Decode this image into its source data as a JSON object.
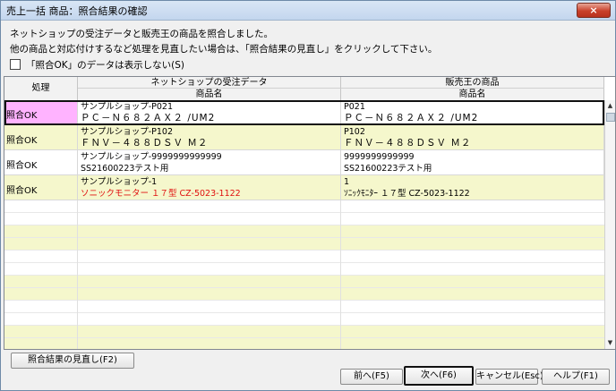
{
  "window": {
    "title": "売上一括 商品：照合結果の確認",
    "close": "×"
  },
  "messages": [
    "ネットショップの受注データと販売王の商品を照合しました。",
    "他の商品と対応付けするなど処理を見直したい場合は、「照合結果の見直し」をクリックして下さい。"
  ],
  "checkbox": {
    "label": "「照合OK」のデータは表示しない(S)",
    "checked": false
  },
  "grid": {
    "headers": {
      "status": "処理",
      "source_group": "ネットショップの受注データ",
      "source_sub": "商品名",
      "target_group": "販売王の商品",
      "target_sub": "商品名"
    },
    "rows": [
      {
        "status": "照合OK",
        "src_line1": "サンプルショップ-P021",
        "src_line2": "ＰＣ－Ｎ６８２ＡＸ２ /UM2",
        "dst_line1": "P021",
        "dst_line2": "ＰＣ－Ｎ６８２ＡＸ２ /UM2"
      },
      {
        "status": "照合OK",
        "src_line1": "サンプルショップ-P102",
        "src_line2": "ＦＮＶ－４８８ＤＳＶ Ｍ２",
        "dst_line1": "P102",
        "dst_line2": "ＦＮＶ－４８８ＤＳＶ Ｍ２"
      },
      {
        "status": "照合OK",
        "src_line1": "サンプルショップ-9999999999999",
        "src_line2": "SS21600223テスト用",
        "dst_line1": "9999999999999",
        "dst_line2": "SS21600223テスト用"
      },
      {
        "status": "照合OK",
        "src_line1": "サンプルショップ-1",
        "src_line2": "ソニックモニター １７型 CZ-5023-1122",
        "dst_line1": "1",
        "dst_line2": "ｿﾆｯｸﾓﾆﾀｰ １７型 CZ-5023-1122"
      }
    ]
  },
  "buttons": {
    "review": "照合結果の見直し(F2)",
    "prev": "前へ(F5)",
    "next": "次へ(F6)",
    "cancel": "キャンセル(Esc)",
    "help": "ヘルプ(F1)"
  },
  "colors": {
    "selected_status_bg": "#ffb3ff",
    "row_alt_bg": "#f5f7cc",
    "error_text": "#e01010"
  }
}
